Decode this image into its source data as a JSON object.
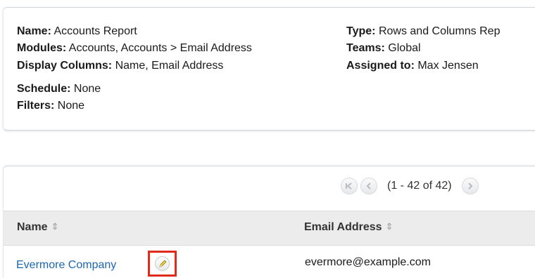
{
  "report": {
    "name_label": "Name:",
    "name_value": "Accounts Report",
    "modules_label": "Modules:",
    "modules_value": "Accounts, Accounts > Email Address",
    "display_columns_label": "Display Columns:",
    "display_columns_value": "Name, Email Address",
    "schedule_label": "Schedule:",
    "schedule_value": "None",
    "filters_label": "Filters:",
    "filters_value": "None",
    "type_label": "Type:",
    "type_value": "Rows and Columns Rep",
    "teams_label": "Teams:",
    "teams_value": "Global",
    "assigned_label": "Assigned to:",
    "assigned_value": "Max Jensen"
  },
  "pager": {
    "first_icon": "first-page-icon",
    "prev_icon": "previous-page-icon",
    "count_text": "(1 - 42 of 42)",
    "next_icon": "next-page-icon"
  },
  "table": {
    "columns": [
      {
        "label": "Name",
        "sort_icon": "sort-icon"
      },
      {
        "label": "Email Address",
        "sort_icon": "sort-icon"
      }
    ],
    "rows": [
      {
        "name": "Evermore Company",
        "email": "evermore@example.com",
        "edit_icon": "pencil-icon"
      }
    ]
  },
  "colors": {
    "link": "#1c66b1",
    "highlight": "#e02a1c",
    "header_bg": "#ececec"
  }
}
